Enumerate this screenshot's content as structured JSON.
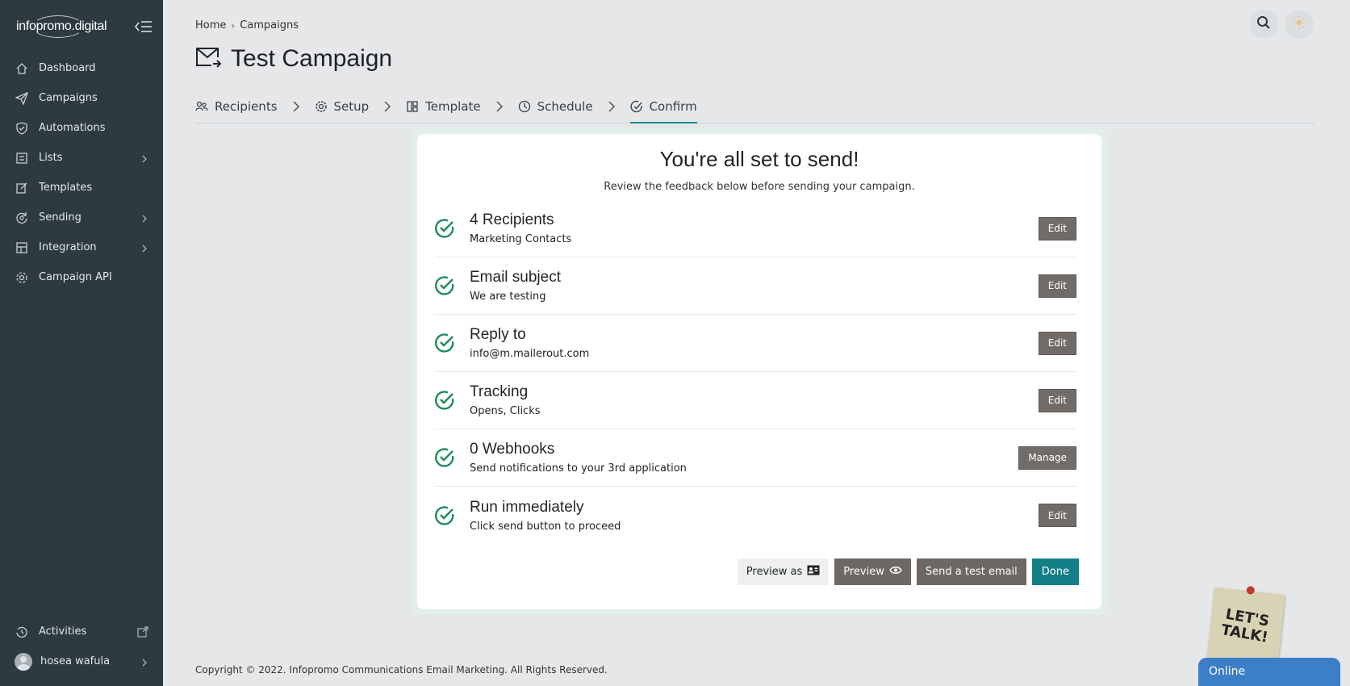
{
  "app": {
    "logo_text": "infopromo.digital"
  },
  "sidebar": {
    "items": [
      {
        "label": "Dashboard",
        "icon": "home-icon",
        "has_children": false
      },
      {
        "label": "Campaigns",
        "icon": "paper-plane-icon",
        "has_children": false
      },
      {
        "label": "Automations",
        "icon": "shield-check-icon",
        "has_children": false
      },
      {
        "label": "Lists",
        "icon": "list-icon",
        "has_children": true
      },
      {
        "label": "Templates",
        "icon": "edit-icon",
        "has_children": false
      },
      {
        "label": "Sending",
        "icon": "refresh-icon",
        "has_children": true
      },
      {
        "label": "Integration",
        "icon": "integration-icon",
        "has_children": true
      },
      {
        "label": "Campaign API",
        "icon": "gear-icon",
        "has_children": false
      }
    ],
    "bottom": {
      "activities_label": "Activities",
      "user_name": "hosea wafula"
    }
  },
  "breadcrumb": {
    "home": "Home",
    "current": "Campaigns"
  },
  "page": {
    "title": "Test Campaign"
  },
  "steps": [
    {
      "label": "Recipients",
      "icon": "users-icon"
    },
    {
      "label": "Setup",
      "icon": "gear-icon"
    },
    {
      "label": "Template",
      "icon": "layout-icon"
    },
    {
      "label": "Schedule",
      "icon": "clock-icon"
    },
    {
      "label": "Confirm",
      "icon": "check-circle-icon",
      "active": true
    }
  ],
  "confirm": {
    "heading": "You're all set to send!",
    "subheading": "Review the feedback below before sending your campaign.",
    "rows": [
      {
        "title": "4 Recipients",
        "desc": "Marketing Contacts",
        "action": "Edit"
      },
      {
        "title": "Email subject",
        "desc": "We are testing",
        "action": "Edit"
      },
      {
        "title": "Reply to",
        "desc": "info@m.mailerout.com",
        "action": "Edit"
      },
      {
        "title": "Tracking",
        "desc": "Opens, Clicks",
        "action": "Edit"
      },
      {
        "title": "0 Webhooks",
        "desc": "Send notifications to your 3rd application",
        "action": "Manage"
      },
      {
        "title": "Run immediately",
        "desc": "Click send button to proceed",
        "action": "Edit"
      }
    ],
    "buttons": {
      "preview_as": "Preview as",
      "preview": "Preview",
      "send_test": "Send a test email",
      "done": "Done"
    }
  },
  "footer": {
    "copyright": "Copyright © 2022. Infopromo Communications Email Marketing. All Rights Reserved."
  },
  "chat": {
    "note_text": "LET'S TALK!",
    "status": "Online"
  },
  "colors": {
    "sidebar_bg": "#2e3a42",
    "accent_teal": "#157f87",
    "check_green": "#1e8a5a",
    "button_gray": "#726c68"
  }
}
